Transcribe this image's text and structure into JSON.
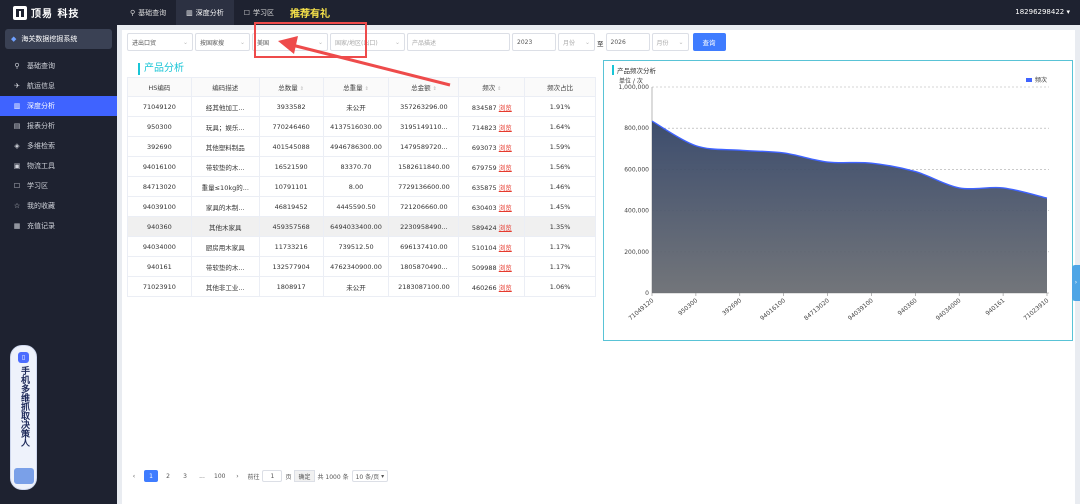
{
  "topbar": {
    "brand": "顶易 科技",
    "nav": [
      {
        "label": "基础查询",
        "icon": "search-user-icon"
      },
      {
        "label": "深度分析",
        "icon": "bar-chart-icon"
      },
      {
        "label": "学习区",
        "icon": "book-icon"
      }
    ],
    "promo": "推荐有礼",
    "phone": "18296298422"
  },
  "sidebar": {
    "system": "海关数据挖掘系统",
    "items": [
      {
        "label": "基础查询",
        "icon": "search-icon"
      },
      {
        "label": "航运信息",
        "icon": "plane-icon"
      },
      {
        "label": "深度分析",
        "icon": "bar-chart-icon"
      },
      {
        "label": "报表分析",
        "icon": "report-icon"
      },
      {
        "label": "多维检索",
        "icon": "cube-icon"
      },
      {
        "label": "物流工具",
        "icon": "truck-icon"
      },
      {
        "label": "学习区",
        "icon": "book-icon"
      },
      {
        "label": "我的收藏",
        "icon": "star-icon"
      },
      {
        "label": "充值记录",
        "icon": "receipt-icon"
      }
    ],
    "banner_text": "手机多维抓取决策人"
  },
  "filters": {
    "trade_type": "进出口贸",
    "group_by": "按国家搜",
    "country": "美国",
    "region_placeholder": "国家/地区(出口)",
    "product_placeholder": "产品描述",
    "start_year": "2023",
    "start_month_placeholder": "月份",
    "range_sep": "至",
    "end_year": "2026",
    "end_month_placeholder": "月份",
    "query_button": "查询"
  },
  "section_title": "产品分析",
  "table": {
    "headers": [
      "HS编码",
      "编码描述",
      "总数量",
      "总重量",
      "总金额",
      "频次",
      "频次占比"
    ],
    "rows": [
      [
        "71049120",
        "经其他加工...",
        "3933582",
        "未公开",
        "357263296.00",
        "834587",
        "浏览",
        "1.91%"
      ],
      [
        "950300",
        "玩具；娱乐...",
        "770246460",
        "4137516030.00",
        "3195149110...",
        "714823",
        "浏览",
        "1.64%"
      ],
      [
        "392690",
        "其他塑料制品",
        "401545088",
        "4946786300.00",
        "1479589720...",
        "693073",
        "浏览",
        "1.59%"
      ],
      [
        "94016100",
        "带软垫的木...",
        "16521590",
        "83370.70",
        "1582611840.00",
        "679759",
        "浏览",
        "1.56%"
      ],
      [
        "84713020",
        "重量≤10kg的...",
        "10791101",
        "8.00",
        "7729136600.00",
        "635875",
        "浏览",
        "1.46%"
      ],
      [
        "94039100",
        "家具的木制...",
        "46819452",
        "4445590.50",
        "721206660.00",
        "630403",
        "浏览",
        "1.45%"
      ],
      [
        "940360",
        "其他木家具",
        "459357568",
        "6494033400.00",
        "2230958490...",
        "589424",
        "浏览",
        "1.35%"
      ],
      [
        "94034000",
        "厨房用木家具",
        "11733216",
        "739512.50",
        "696137410.00",
        "510104",
        "浏览",
        "1.17%"
      ],
      [
        "940161",
        "带软垫的木...",
        "132577904",
        "4762340900.00",
        "1805870490...",
        "509988",
        "浏览",
        "1.17%"
      ],
      [
        "71023910",
        "其他非工业...",
        "1808917",
        "未公开",
        "2183087100.00",
        "460266",
        "浏览",
        "1.06%"
      ]
    ]
  },
  "pagination": {
    "prev": "‹",
    "pages": [
      "1",
      "2",
      "3",
      "...",
      "100"
    ],
    "next": "›",
    "goto_label": "前往",
    "goto_value": "1",
    "page_unit": "页",
    "confirm": "确定",
    "total": "共 1000 条",
    "page_size": "10 条/页"
  },
  "chart": {
    "title": "产品频次分析",
    "accent": "#3f63ff",
    "area_color": "#364a6e"
  },
  "chart_data": {
    "type": "area",
    "unit_label": "单位 / 次",
    "categories": [
      "71049120",
      "950300",
      "392690",
      "94016100",
      "84713020",
      "94039100",
      "940360",
      "94034000",
      "940161",
      "71023910"
    ],
    "series": [
      {
        "name": "频次",
        "values": [
          834587,
          714823,
          693073,
          679759,
          635875,
          630403,
          589424,
          510104,
          509988,
          460266
        ]
      }
    ],
    "yticks": [
      "0",
      "200,000",
      "400,000",
      "600,000",
      "800,000",
      "1,000,000"
    ],
    "ylim": [
      0,
      1000000
    ],
    "legend": "top-right",
    "grid": true
  }
}
